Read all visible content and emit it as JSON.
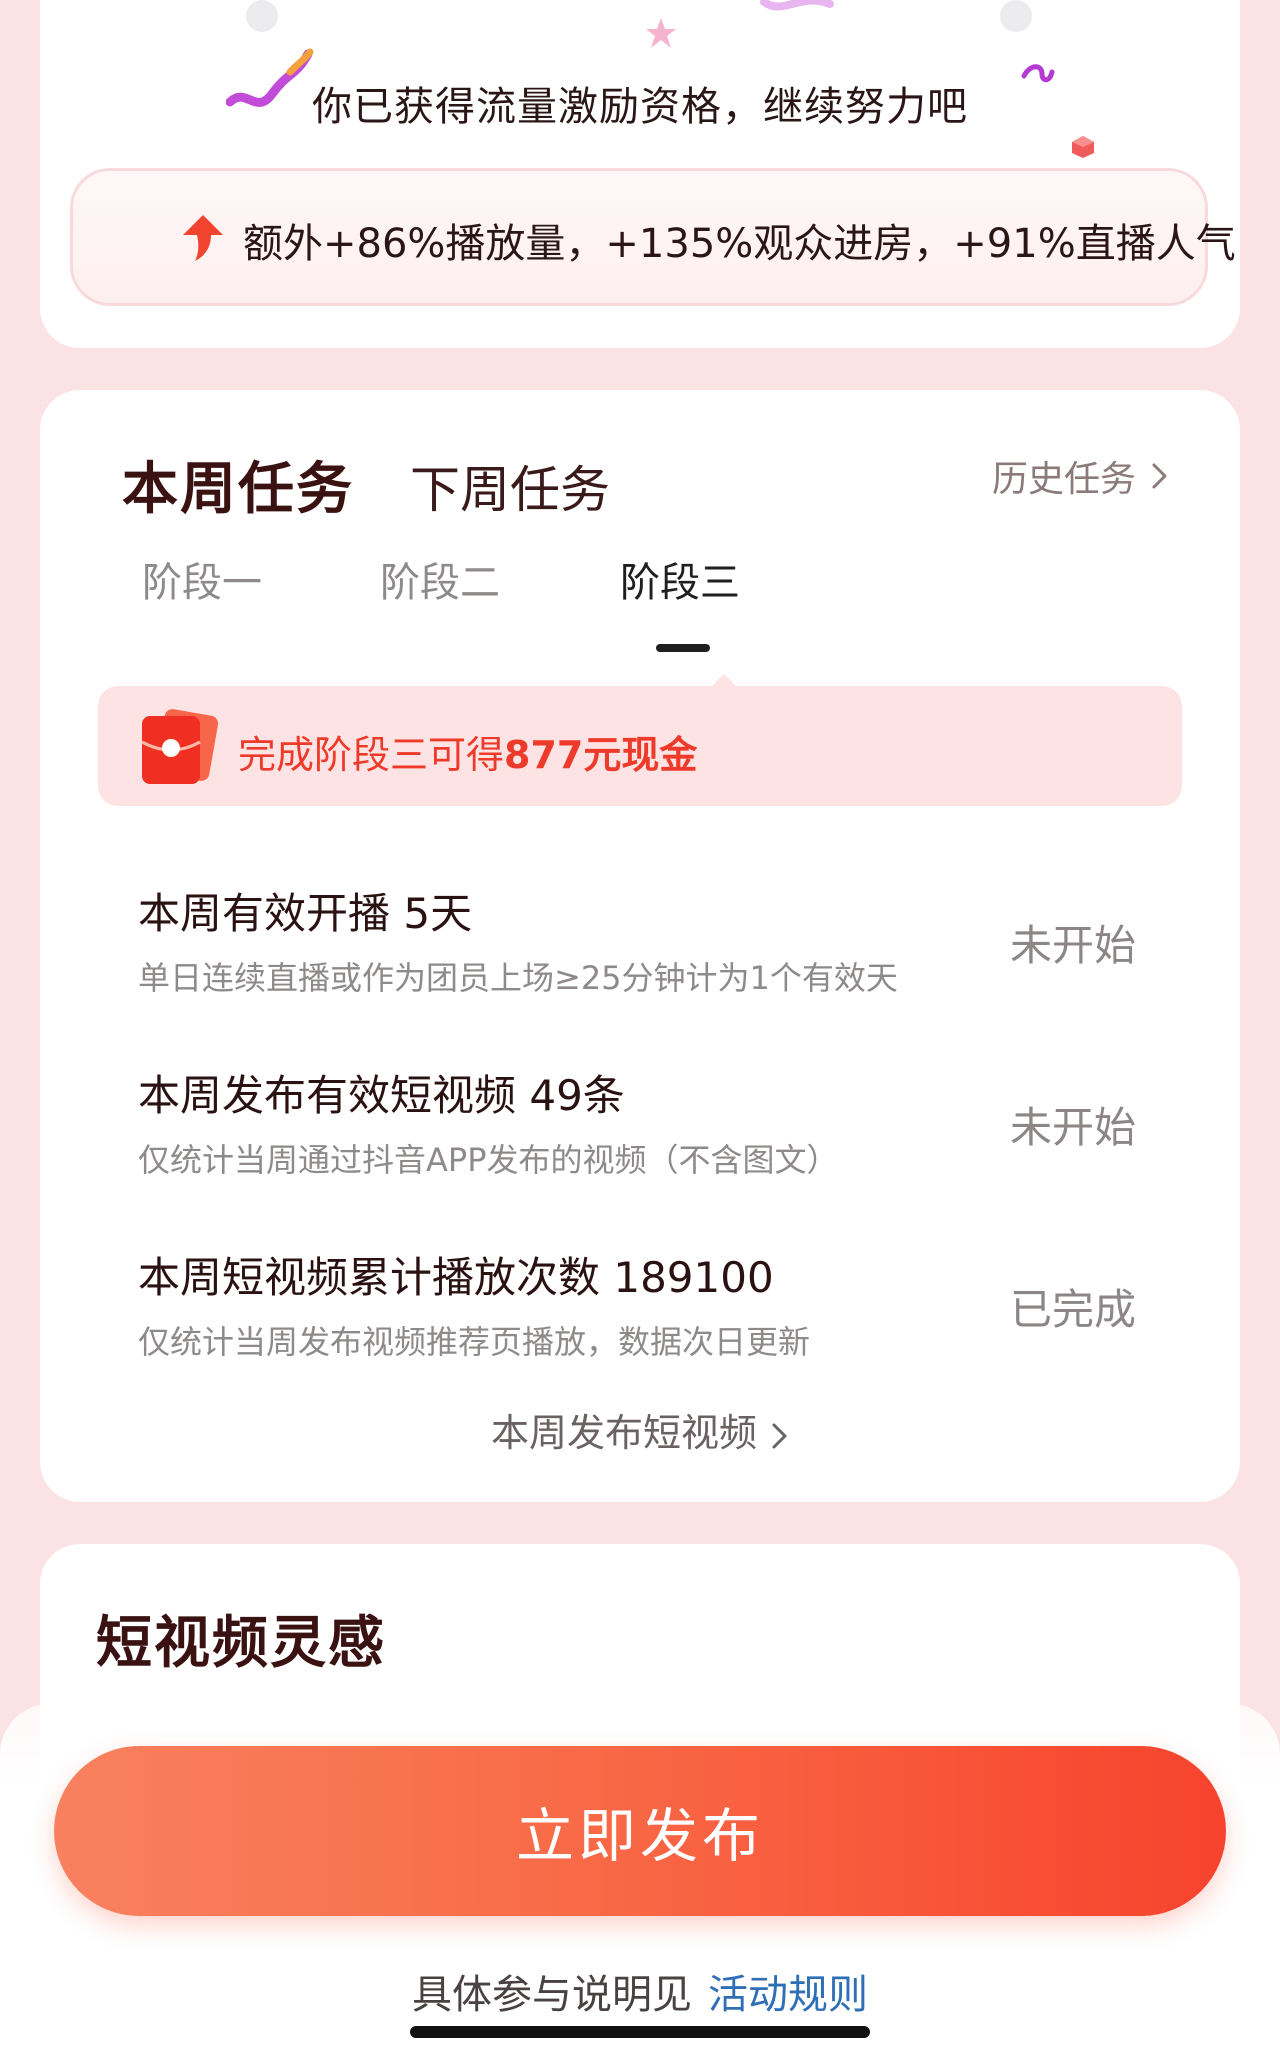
{
  "qualification": {
    "title": "你已获得流量激励资格，继续努力吧",
    "boost_text": "额外+86%播放量，+135%观众进房，+91%直播人气"
  },
  "tasks_card": {
    "tab_current": "本周任务",
    "tab_next": "下周任务",
    "history_link": "历史任务",
    "stages": [
      "阶段一",
      "阶段二",
      "阶段三"
    ],
    "active_stage": "阶段三",
    "reward_prefix": "完成阶段三可得",
    "reward_amount": "877元现金",
    "tasks": [
      {
        "title": "本周有效开播 5天",
        "desc": "单日连续直播或作为团员上场≥25分钟计为1个有效天",
        "status": "未开始"
      },
      {
        "title": "本周发布有效短视频 49条",
        "desc": "仅统计当周通过抖音APP发布的视频（不含图文）",
        "status": "未开始"
      },
      {
        "title": "本周短视频累计播放次数 189100",
        "desc": "仅统计当周发布视频推荐页播放，数据次日更新",
        "status": "已完成"
      }
    ],
    "publish_link": "本周发布短视频"
  },
  "inspiration": {
    "title": "短视频灵感"
  },
  "bottom": {
    "publish_button": "立即发布",
    "rules_prefix": "具体参与说明见",
    "rules_link": "活动规则"
  },
  "colors": {
    "page_bg": "#fbe3e5",
    "accent_red": "#ee3a2a",
    "button_gradient_start": "#f9815f",
    "button_gradient_end": "#f7432d",
    "link_blue": "#2f6fb5"
  },
  "icons": {
    "boost": "up-arrow-icon",
    "reward": "red-envelope-icon",
    "chevron": "chevron-right-icon"
  }
}
